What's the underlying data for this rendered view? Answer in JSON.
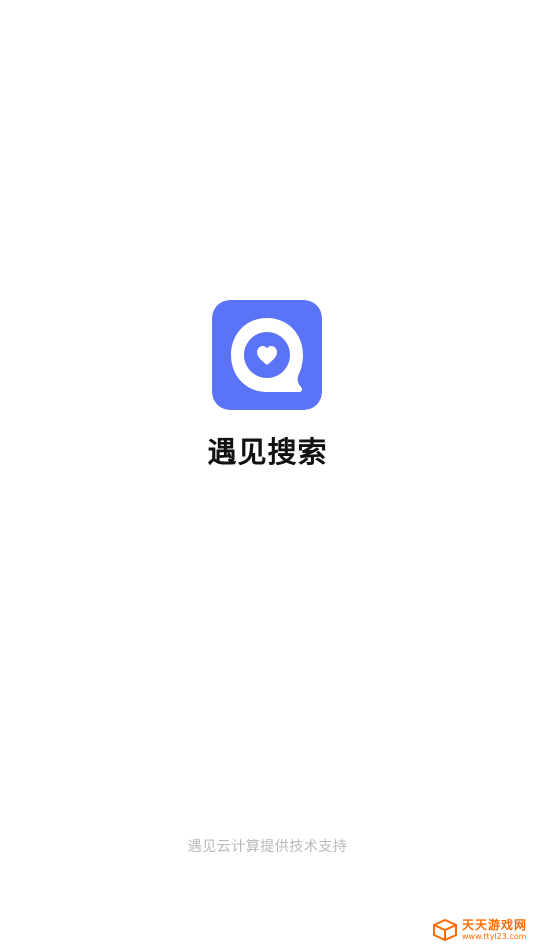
{
  "app": {
    "name": "遇见搜索",
    "icon": "chat-bubble-heart-icon",
    "brand_color": "#5b73f6"
  },
  "footer": {
    "support_text": "遇见云计算提供技术支持"
  },
  "watermark": {
    "title": "天天游戏网",
    "url": "www.ttyl23.com",
    "icon": "cube-logo-icon",
    "color": "#ff6a00"
  }
}
